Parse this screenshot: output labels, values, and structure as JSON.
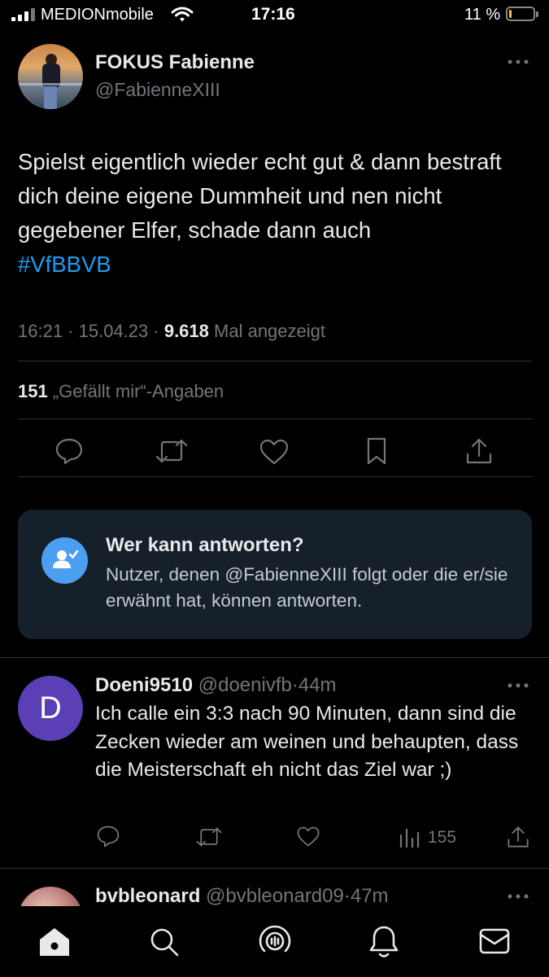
{
  "status_bar": {
    "carrier": "MEDIONmobile",
    "time": "17:16",
    "battery": "11 %",
    "battery_level": 0.11
  },
  "tweet": {
    "display_name": "FOKUS Fabienne",
    "handle": "@FabienneXIII",
    "text": "Spielst eigentlich wieder echt gut & dann bestraft dich deine eigene Dummheit und nen nicht gegebener Elfer, schade dann auch",
    "hashtag": "#VfBBVB",
    "time": "16:21",
    "date": "15.04.23",
    "views": "9.618",
    "views_label": "Mal angezeigt",
    "likes": "151",
    "likes_label": "„Gefällt mir“-Angaben",
    "more_icon": "ellipsis-icon"
  },
  "actions": [
    "reply-icon",
    "retweet-icon",
    "like-icon",
    "bookmark-icon",
    "share-icon"
  ],
  "reply_restriction": {
    "title": "Wer kann antworten?",
    "description": "Nutzer, denen @FabienneXIII folgt oder die er/sie erwähnt hat, können antworten."
  },
  "replies": [
    {
      "avatar_letter": "D",
      "avatar_color": "#5b3fb6",
      "display_name": "Doeni9510",
      "handle": "@doenivfb",
      "age": "44m",
      "text": "Ich calle ein 3:3 nach 90 Minuten, dann sind die Zecken wieder am weinen und behaupten, dass die Meisterschaft eh nicht das Ziel war ;)",
      "views": "155"
    },
    {
      "display_name": "bvbleonard",
      "handle": "@bvbleonard09",
      "age": "47m"
    }
  ],
  "bottom_nav": [
    "home-icon",
    "search-icon",
    "spaces-icon",
    "notifications-icon",
    "messages-icon"
  ],
  "colors": {
    "background": "#000000",
    "text": "#e7e9ea",
    "muted": "#71767b",
    "link": "#1d9bf0",
    "card": "#16202b",
    "accent_blue": "#4c9ef0"
  }
}
